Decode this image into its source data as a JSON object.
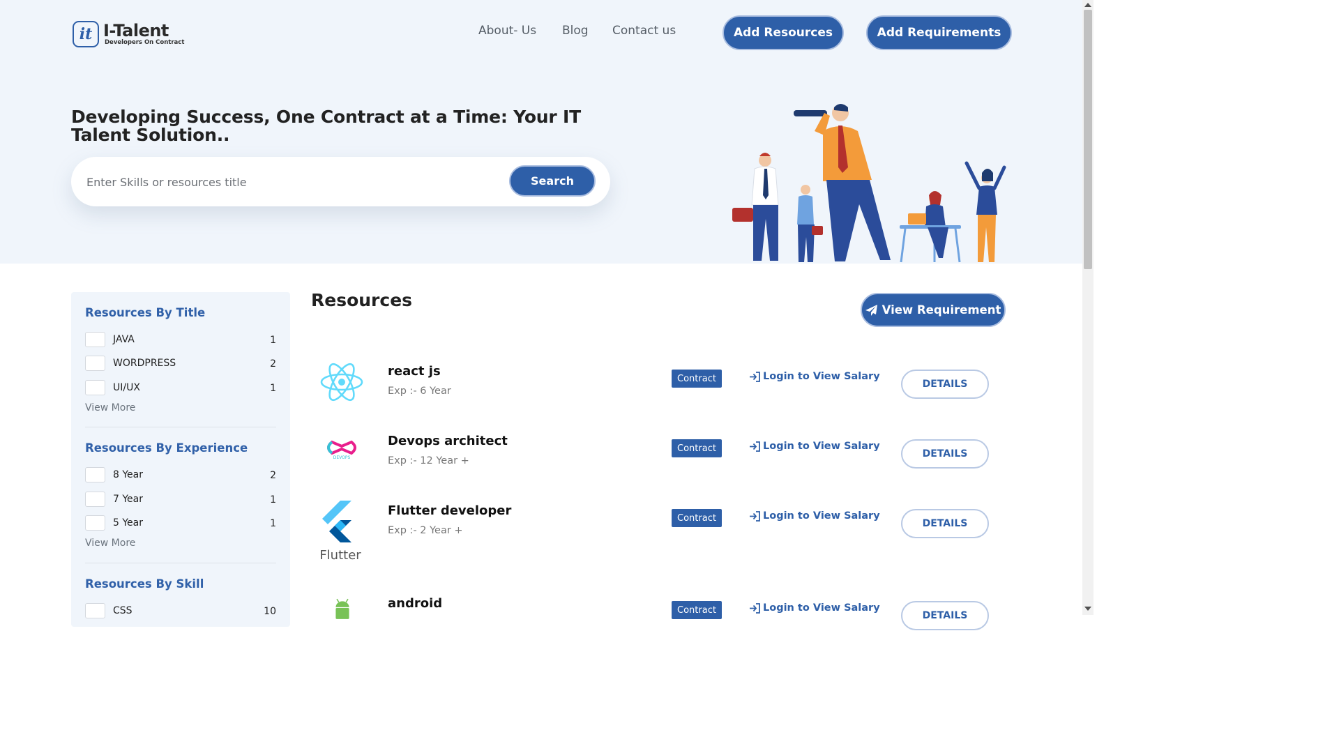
{
  "header": {
    "logo_badge": "it",
    "logo_title": "I-Talent",
    "logo_subtitle": "Developers On Contract",
    "nav": [
      "About- Us",
      "Blog",
      "Contact us"
    ],
    "add_resources": "Add Resources",
    "add_requirements": "Add Requirements"
  },
  "hero": {
    "title": "Developing Success, One Contract at a Time: Your IT Talent Solution..",
    "search_placeholder": "Enter Skills or resources title",
    "search_button": "Search"
  },
  "sidebar": {
    "groups": [
      {
        "title": "Resources By Title",
        "items": [
          {
            "label": "JAVA",
            "count": "1"
          },
          {
            "label": "WORDPRESS",
            "count": "2"
          },
          {
            "label": "UI/UX",
            "count": "1"
          }
        ],
        "view_more": "View More"
      },
      {
        "title": "Resources By Experience",
        "items": [
          {
            "label": "8 Year",
            "count": "2"
          },
          {
            "label": "7 Year",
            "count": "1"
          },
          {
            "label": "5 Year",
            "count": "1"
          }
        ],
        "view_more": "View More"
      },
      {
        "title": "Resources By Skill",
        "items": [
          {
            "label": "CSS",
            "count": "10"
          }
        ]
      }
    ]
  },
  "resources": {
    "heading": "Resources",
    "view_requirement": "View Requirement",
    "items": [
      {
        "name": "react js",
        "exp": "Exp :- 6 Year",
        "badge": "Contract",
        "salary": "Login to View Salary",
        "details": "DETAILS",
        "icon": "react-icon"
      },
      {
        "name": "Devops architect",
        "exp": "Exp :- 12 Year +",
        "badge": "Contract",
        "salary": "Login to View Salary",
        "details": "DETAILS",
        "icon": "devops-icon",
        "logo_text": "DEVOPS"
      },
      {
        "name": "Flutter developer",
        "exp": "Exp :- 2 Year +",
        "badge": "Contract",
        "salary": "Login to View Salary",
        "details": "DETAILS",
        "icon": "flutter-icon",
        "logo_text": "Flutter"
      },
      {
        "name": "android",
        "exp": "",
        "badge": "Contract",
        "salary": "Login to View Salary",
        "details": "DETAILS",
        "icon": "android-icon"
      }
    ]
  },
  "colors": {
    "primary": "#2e5fa8",
    "hero_bg": "#f0f5fb",
    "filter_title": "#3161a9"
  }
}
